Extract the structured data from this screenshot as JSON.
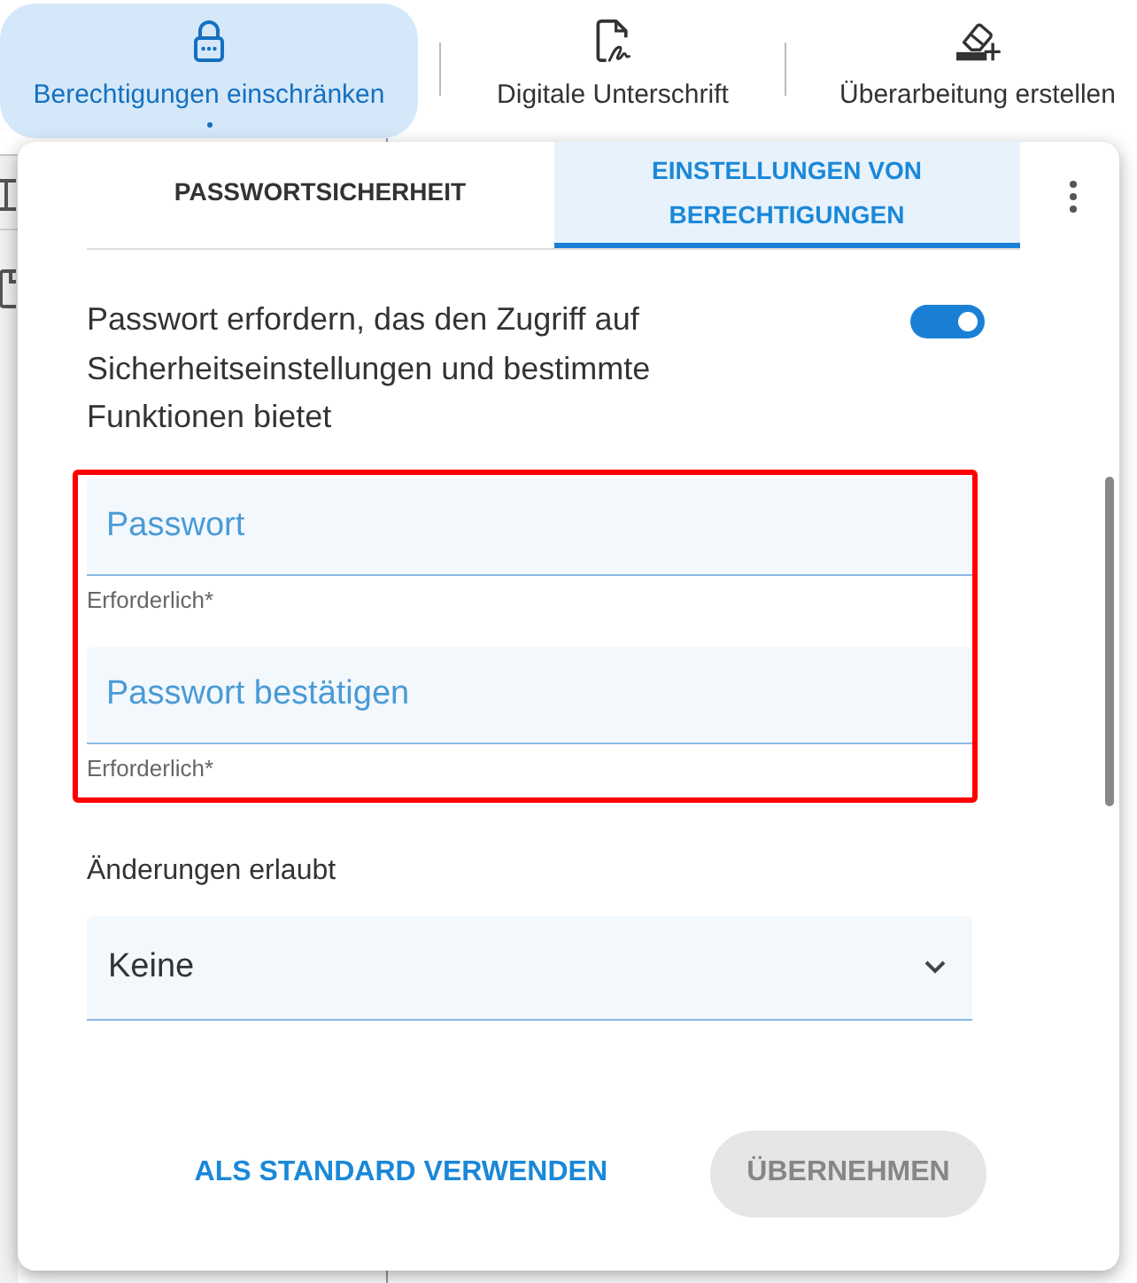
{
  "toolbar": {
    "items": [
      {
        "label": "Berechtigungen einschränken",
        "selected": true
      },
      {
        "label": "Digitale Unterschrift",
        "selected": false
      },
      {
        "label": "Überarbeitung erstellen",
        "selected": false
      }
    ]
  },
  "panel": {
    "tabs": [
      {
        "label": "PASSWORTSICHERHEIT",
        "selected": false
      },
      {
        "label": "EINSTELLUNGEN VON BERECHTIGUNGEN",
        "selected": true
      }
    ],
    "toggle": {
      "label": "Passwort erfordern, das den Zugriff auf Sicherheitseinstellungen und bestimmte Funktionen bietet",
      "on": true
    },
    "fields": [
      {
        "placeholder": "Passwort",
        "helper": "Erforderlich*"
      },
      {
        "placeholder": "Passwort bestätigen",
        "helper": "Erforderlich*"
      }
    ],
    "select": {
      "label": "Änderungen erlaubt",
      "value": "Keine"
    },
    "buttons": [
      {
        "label": "ALS STANDARD VERWENDEN",
        "kind": "text",
        "disabled": false
      },
      {
        "label": "ÜBERNEHMEN",
        "kind": "filled",
        "disabled": true
      }
    ]
  }
}
